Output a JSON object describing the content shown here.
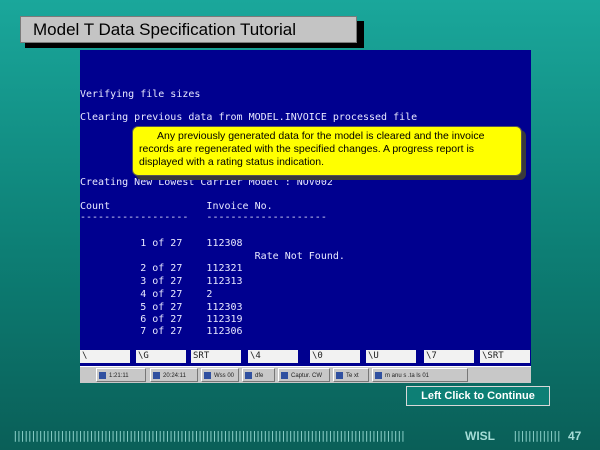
{
  "slide": {
    "title": "Model T Data Specification Tutorial",
    "continue_label": "Left Click to Continue",
    "footer_brand": "WISL",
    "page_number": "47",
    "footer_bars_left": "||||||||||||||||||||||||||||||||||||||||||||||||||||||||||||||||||||||||||||||||||||||||||||||||||||||||||||",
    "footer_bars_right": "|||||||||||||||"
  },
  "terminal": {
    "lines": [
      "Verifying file sizes",
      "Clearing previous data from MODEL.INVOICE processed file",
      "Creating New Lowest Carrier Model : NOV002",
      "Count                Invoice No.",
      "------------------   --------------------",
      "          1 of 27    112308",
      "                             Rate Not Found.",
      "          2 of 27    112321",
      "          3 of 27    112313",
      "          4 of 27    2",
      "          5 of 27    112303",
      "          6 of 27    112319",
      "          7 of 27    112306"
    ]
  },
  "callout": {
    "text": "Any previously generated data for the model is cleared and the invoice records are regenerated with the specified changes. A progress report is displayed with a rating status indication."
  },
  "function_keys": [
    "\\",
    "\\G",
    "SRT",
    "\\4",
    "\\0",
    "\\U",
    "\\7",
    "\\SRT"
  ],
  "taskbar": {
    "items": [
      "1:21:11",
      "20:24:11",
      "Wss 00",
      "dfe",
      "Captur. CW",
      "Te xt",
      "m anu s .ta ls 01"
    ]
  }
}
